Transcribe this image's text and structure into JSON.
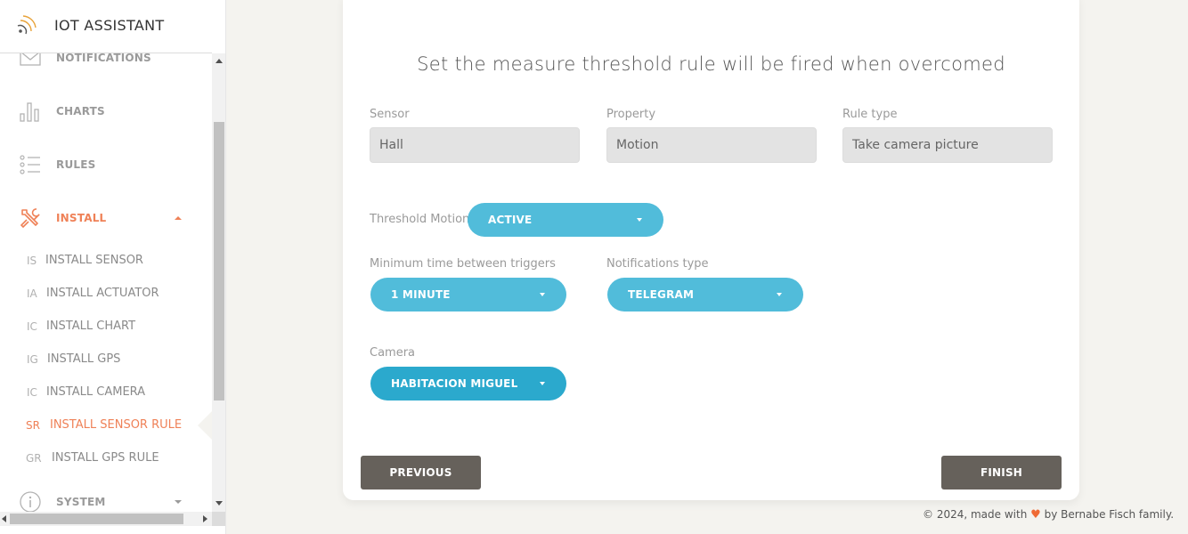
{
  "app": {
    "title": "IOT ASSISTANT"
  },
  "sidebar": {
    "items": [
      {
        "label": "NOTIFICATIONS",
        "icon": "envelope-icon"
      },
      {
        "label": "CHARTS",
        "icon": "bar-chart-icon"
      },
      {
        "label": "RULES",
        "icon": "list-icon"
      },
      {
        "label": "INSTALL",
        "icon": "tools-icon",
        "active": true,
        "expanded": true
      },
      {
        "label": "SYSTEM",
        "icon": "info-icon",
        "expanded": false
      }
    ],
    "install_items": [
      {
        "abbr": "IS",
        "label": "INSTALL SENSOR"
      },
      {
        "abbr": "IA",
        "label": "INSTALL ACTUATOR"
      },
      {
        "abbr": "IC",
        "label": "INSTALL CHART"
      },
      {
        "abbr": "IG",
        "label": "INSTALL GPS"
      },
      {
        "abbr": "IC",
        "label": "INSTALL CAMERA"
      },
      {
        "abbr": "SR",
        "label": "INSTALL SENSOR RULE",
        "active": true
      },
      {
        "abbr": "GR",
        "label": "INSTALL GPS RULE"
      }
    ]
  },
  "form": {
    "heading": "Set the measure threshold rule will be fired when overcomed",
    "sensor": {
      "label": "Sensor",
      "value": "Hall"
    },
    "property": {
      "label": "Property",
      "value": "Motion"
    },
    "rule_type": {
      "label": "Rule type",
      "value": "Take camera picture"
    },
    "threshold": {
      "label": "Threshold Motion",
      "value": "ACTIVE"
    },
    "min_time": {
      "label": "Minimum time between triggers",
      "value": "1 MINUTE"
    },
    "notifications": {
      "label": "Notifications type",
      "value": "TELEGRAM"
    },
    "camera": {
      "label": "Camera",
      "value": "HABITACION MIGUEL"
    },
    "previous_label": "PREVIOUS",
    "finish_label": "FINISH"
  },
  "footer": {
    "prefix": "© 2024, made with",
    "heart": "♥",
    "suffix": "by Bernabe Fisch family."
  },
  "colors": {
    "accent": "#ef8157",
    "pill": "#51bcda",
    "pill_dark": "#2ba9cd",
    "button": "#66615b",
    "background": "#f4f3ef"
  }
}
